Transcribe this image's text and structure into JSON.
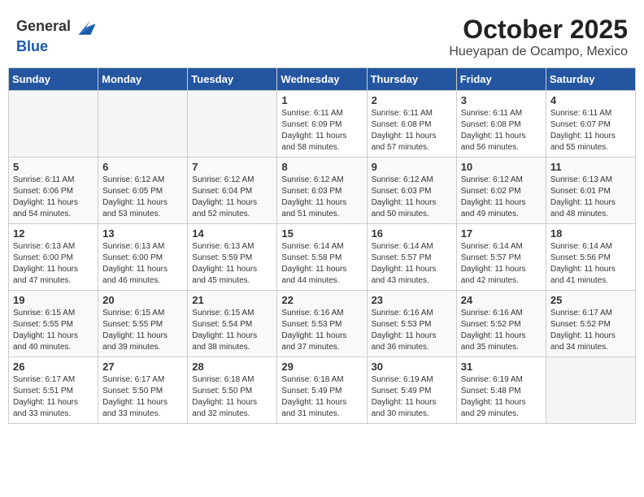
{
  "header": {
    "logo_general": "General",
    "logo_blue": "Blue",
    "title": "October 2025",
    "location": "Hueyapan de Ocampo, Mexico"
  },
  "weekdays": [
    "Sunday",
    "Monday",
    "Tuesday",
    "Wednesday",
    "Thursday",
    "Friday",
    "Saturday"
  ],
  "weeks": [
    [
      {
        "day": "",
        "info": ""
      },
      {
        "day": "",
        "info": ""
      },
      {
        "day": "",
        "info": ""
      },
      {
        "day": "1",
        "info": "Sunrise: 6:11 AM\nSunset: 6:09 PM\nDaylight: 11 hours\nand 58 minutes."
      },
      {
        "day": "2",
        "info": "Sunrise: 6:11 AM\nSunset: 6:08 PM\nDaylight: 11 hours\nand 57 minutes."
      },
      {
        "day": "3",
        "info": "Sunrise: 6:11 AM\nSunset: 6:08 PM\nDaylight: 11 hours\nand 56 minutes."
      },
      {
        "day": "4",
        "info": "Sunrise: 6:11 AM\nSunset: 6:07 PM\nDaylight: 11 hours\nand 55 minutes."
      }
    ],
    [
      {
        "day": "5",
        "info": "Sunrise: 6:11 AM\nSunset: 6:06 PM\nDaylight: 11 hours\nand 54 minutes."
      },
      {
        "day": "6",
        "info": "Sunrise: 6:12 AM\nSunset: 6:05 PM\nDaylight: 11 hours\nand 53 minutes."
      },
      {
        "day": "7",
        "info": "Sunrise: 6:12 AM\nSunset: 6:04 PM\nDaylight: 11 hours\nand 52 minutes."
      },
      {
        "day": "8",
        "info": "Sunrise: 6:12 AM\nSunset: 6:03 PM\nDaylight: 11 hours\nand 51 minutes."
      },
      {
        "day": "9",
        "info": "Sunrise: 6:12 AM\nSunset: 6:03 PM\nDaylight: 11 hours\nand 50 minutes."
      },
      {
        "day": "10",
        "info": "Sunrise: 6:12 AM\nSunset: 6:02 PM\nDaylight: 11 hours\nand 49 minutes."
      },
      {
        "day": "11",
        "info": "Sunrise: 6:13 AM\nSunset: 6:01 PM\nDaylight: 11 hours\nand 48 minutes."
      }
    ],
    [
      {
        "day": "12",
        "info": "Sunrise: 6:13 AM\nSunset: 6:00 PM\nDaylight: 11 hours\nand 47 minutes."
      },
      {
        "day": "13",
        "info": "Sunrise: 6:13 AM\nSunset: 6:00 PM\nDaylight: 11 hours\nand 46 minutes."
      },
      {
        "day": "14",
        "info": "Sunrise: 6:13 AM\nSunset: 5:59 PM\nDaylight: 11 hours\nand 45 minutes."
      },
      {
        "day": "15",
        "info": "Sunrise: 6:14 AM\nSunset: 5:58 PM\nDaylight: 11 hours\nand 44 minutes."
      },
      {
        "day": "16",
        "info": "Sunrise: 6:14 AM\nSunset: 5:57 PM\nDaylight: 11 hours\nand 43 minutes."
      },
      {
        "day": "17",
        "info": "Sunrise: 6:14 AM\nSunset: 5:57 PM\nDaylight: 11 hours\nand 42 minutes."
      },
      {
        "day": "18",
        "info": "Sunrise: 6:14 AM\nSunset: 5:56 PM\nDaylight: 11 hours\nand 41 minutes."
      }
    ],
    [
      {
        "day": "19",
        "info": "Sunrise: 6:15 AM\nSunset: 5:55 PM\nDaylight: 11 hours\nand 40 minutes."
      },
      {
        "day": "20",
        "info": "Sunrise: 6:15 AM\nSunset: 5:55 PM\nDaylight: 11 hours\nand 39 minutes."
      },
      {
        "day": "21",
        "info": "Sunrise: 6:15 AM\nSunset: 5:54 PM\nDaylight: 11 hours\nand 38 minutes."
      },
      {
        "day": "22",
        "info": "Sunrise: 6:16 AM\nSunset: 5:53 PM\nDaylight: 11 hours\nand 37 minutes."
      },
      {
        "day": "23",
        "info": "Sunrise: 6:16 AM\nSunset: 5:53 PM\nDaylight: 11 hours\nand 36 minutes."
      },
      {
        "day": "24",
        "info": "Sunrise: 6:16 AM\nSunset: 5:52 PM\nDaylight: 11 hours\nand 35 minutes."
      },
      {
        "day": "25",
        "info": "Sunrise: 6:17 AM\nSunset: 5:52 PM\nDaylight: 11 hours\nand 34 minutes."
      }
    ],
    [
      {
        "day": "26",
        "info": "Sunrise: 6:17 AM\nSunset: 5:51 PM\nDaylight: 11 hours\nand 33 minutes."
      },
      {
        "day": "27",
        "info": "Sunrise: 6:17 AM\nSunset: 5:50 PM\nDaylight: 11 hours\nand 33 minutes."
      },
      {
        "day": "28",
        "info": "Sunrise: 6:18 AM\nSunset: 5:50 PM\nDaylight: 11 hours\nand 32 minutes."
      },
      {
        "day": "29",
        "info": "Sunrise: 6:18 AM\nSunset: 5:49 PM\nDaylight: 11 hours\nand 31 minutes."
      },
      {
        "day": "30",
        "info": "Sunrise: 6:19 AM\nSunset: 5:49 PM\nDaylight: 11 hours\nand 30 minutes."
      },
      {
        "day": "31",
        "info": "Sunrise: 6:19 AM\nSunset: 5:48 PM\nDaylight: 11 hours\nand 29 minutes."
      },
      {
        "day": "",
        "info": ""
      }
    ]
  ]
}
